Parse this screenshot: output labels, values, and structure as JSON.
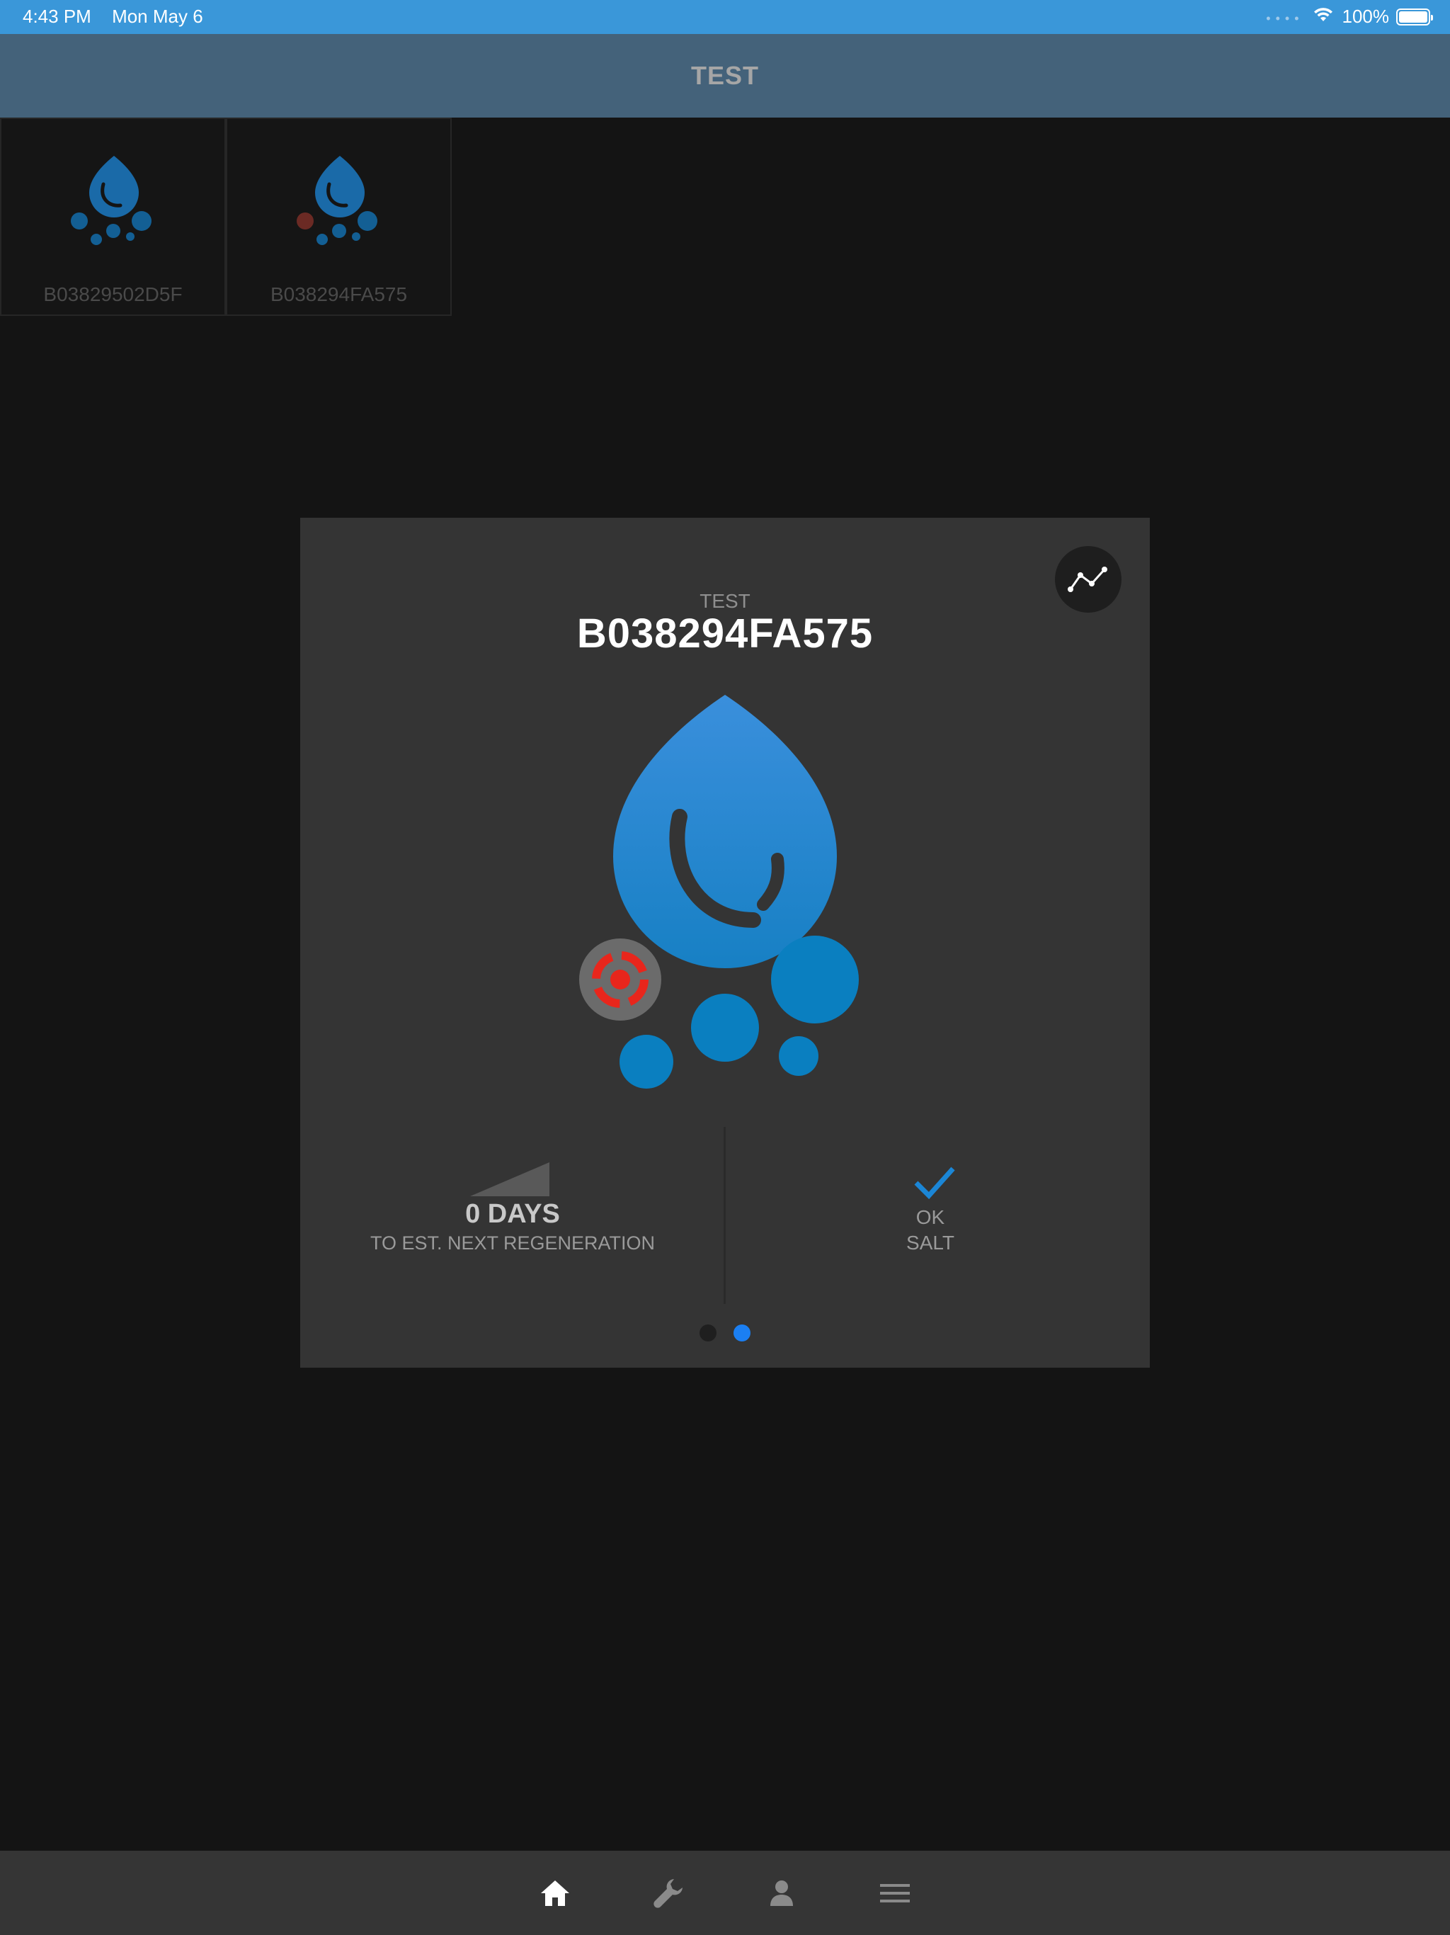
{
  "status_bar": {
    "time": "4:43 PM",
    "date": "Mon May 6",
    "battery": "100%"
  },
  "nav": {
    "title": "TEST"
  },
  "devices": [
    {
      "label": "B03829502D5F",
      "alert": false
    },
    {
      "label": "B038294FA575",
      "alert": true
    }
  ],
  "detail": {
    "subtitle": "TEST",
    "title": "B038294FA575",
    "regeneration": {
      "days": "0 DAYS",
      "caption": "TO EST. NEXT REGENERATION"
    },
    "salt": {
      "status": "OK",
      "label": "SALT"
    },
    "pages": {
      "count": 2,
      "current": 2
    }
  },
  "tabs": [
    {
      "icon": "home-icon",
      "active": true
    },
    {
      "icon": "wrench-icon",
      "active": false
    },
    {
      "icon": "person-icon",
      "active": false
    },
    {
      "icon": "menu-icon",
      "active": false
    }
  ],
  "colors": {
    "accent_blue": "#1b86d6",
    "status_bar": "#3a97d9",
    "nav_bar": "#44627a",
    "alert_red": "#e8261c"
  }
}
